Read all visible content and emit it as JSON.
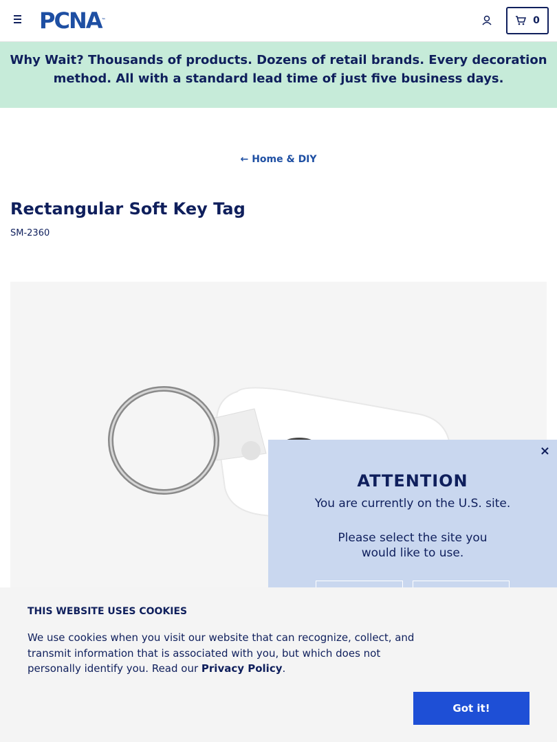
{
  "header": {
    "logo_text": "PCNA",
    "logo_tm": "™",
    "cart_count": "0"
  },
  "promo": {
    "text": "Why Wait? Thousands of products. Dozens of retail brands. Every decoration method. All with a standard lead time of just five business days."
  },
  "breadcrumb": {
    "arrow": "←",
    "label": "Home & DIY"
  },
  "product": {
    "title": "Rectangular Soft Key Tag",
    "sku": "SM-2360"
  },
  "site_modal": {
    "close": "×",
    "heading": "ATTENTION",
    "current_site": "You are currently on the U.S. site.",
    "prompt": "Please select the site you would like to use."
  },
  "cookie_banner": {
    "title": "THIS WEBSITE USES COOKIES",
    "text": "We use cookies when you visit our website that can recognize, collect, and transmit information that is associated with you, but which does not personally identify you. Read our ",
    "link": "Privacy Policy",
    "text_end": ".",
    "button": "Got it!"
  },
  "colors": {
    "navy": "#0f1f5c",
    "brand_blue": "#1e4fa3",
    "promo_bg": "#c6ebd9",
    "modal_bg": "#c9d7ef",
    "cookie_button": "#1e4fd6"
  },
  "icons": [
    "menu-icon",
    "user-icon",
    "cart-icon",
    "arrow-left-icon",
    "close-icon"
  ]
}
